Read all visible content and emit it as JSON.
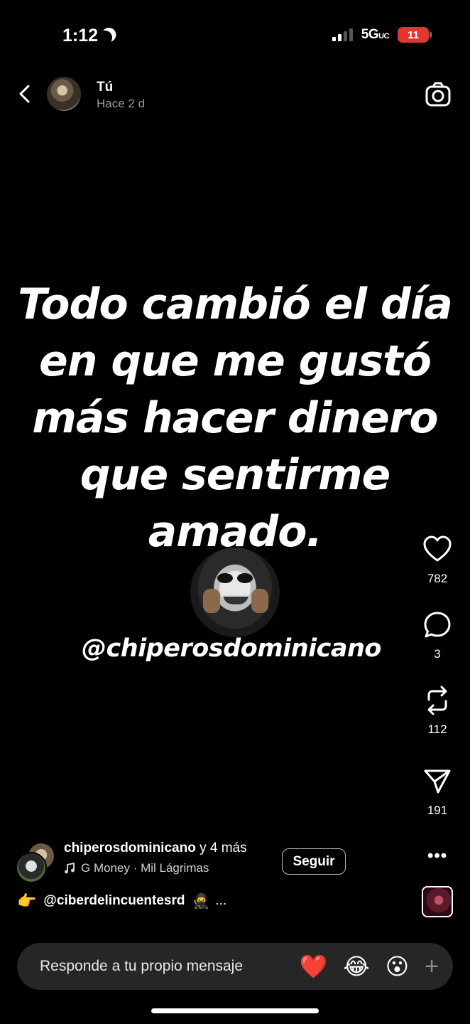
{
  "status_bar": {
    "time": "1:12",
    "network": "5G",
    "network_suffix": "UC",
    "battery": "11"
  },
  "header": {
    "name": "Tú",
    "time_ago": "Hace 2 d"
  },
  "story": {
    "quote_lines": [
      "Todo cambió el día",
      "en que me gustó",
      "más hacer dinero",
      "que sentirme",
      "amado."
    ],
    "handle": "@chiperosdominicano"
  },
  "actions": {
    "likes": "782",
    "comments": "3",
    "reposts": "112",
    "shares": "191"
  },
  "footer": {
    "credit_user": "chiperosdominicano",
    "credit_more": "y 4 más",
    "song": "G Money · Mil Lágrimas",
    "follow_label": "Seguir",
    "more_label": "•••",
    "mention": "@ciberdelincuentesrd",
    "mention_tail": "..."
  },
  "reply": {
    "placeholder": "Responde a tu propio mensaje",
    "emojis": [
      "❤️",
      "😂",
      "😮"
    ]
  },
  "colors": {
    "background": "#000000",
    "reply_bar": "#262626",
    "battery": "#e0382f",
    "heart": "#e8202a"
  }
}
